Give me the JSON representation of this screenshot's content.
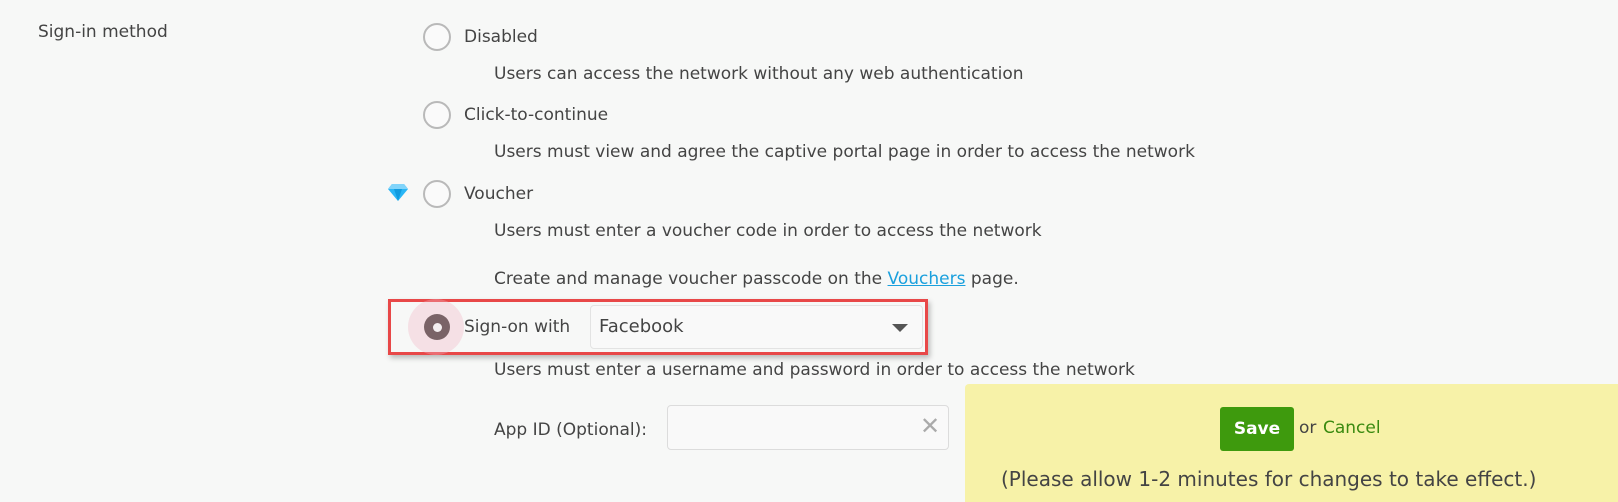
{
  "section": {
    "label": "Sign-in method"
  },
  "options": [
    {
      "label": "Disabled",
      "description": "Users can access the network without any web authentication",
      "selected": false
    },
    {
      "label": "Click-to-continue",
      "description": "Users must view and agree the captive portal page in order to access the network",
      "selected": false
    },
    {
      "label": "Voucher",
      "premium_icon": "diamond-icon",
      "description": "Users must enter a voucher code in order to access the network",
      "extra_prefix": "Create and manage voucher passcode on the",
      "extra_link": "Vouchers",
      "extra_suffix": "page.",
      "selected": false
    },
    {
      "label": "Sign-on with",
      "provider_value": "Facebook",
      "description": "Users must enter a username and password in order to access the network",
      "selected": true
    }
  ],
  "app_id": {
    "label": "App ID (Optional):",
    "value": "",
    "placeholder": ""
  },
  "save_bar": {
    "save_label": "Save",
    "or_text": "or",
    "cancel_label": "Cancel",
    "note": "(Please allow 1-2 minutes for changes to take effect.)"
  },
  "colors": {
    "save_button": "#3e9a0d",
    "highlight": "#e84848",
    "link": "#1aa0dd",
    "save_bar_bg": "#f7f2a8"
  }
}
